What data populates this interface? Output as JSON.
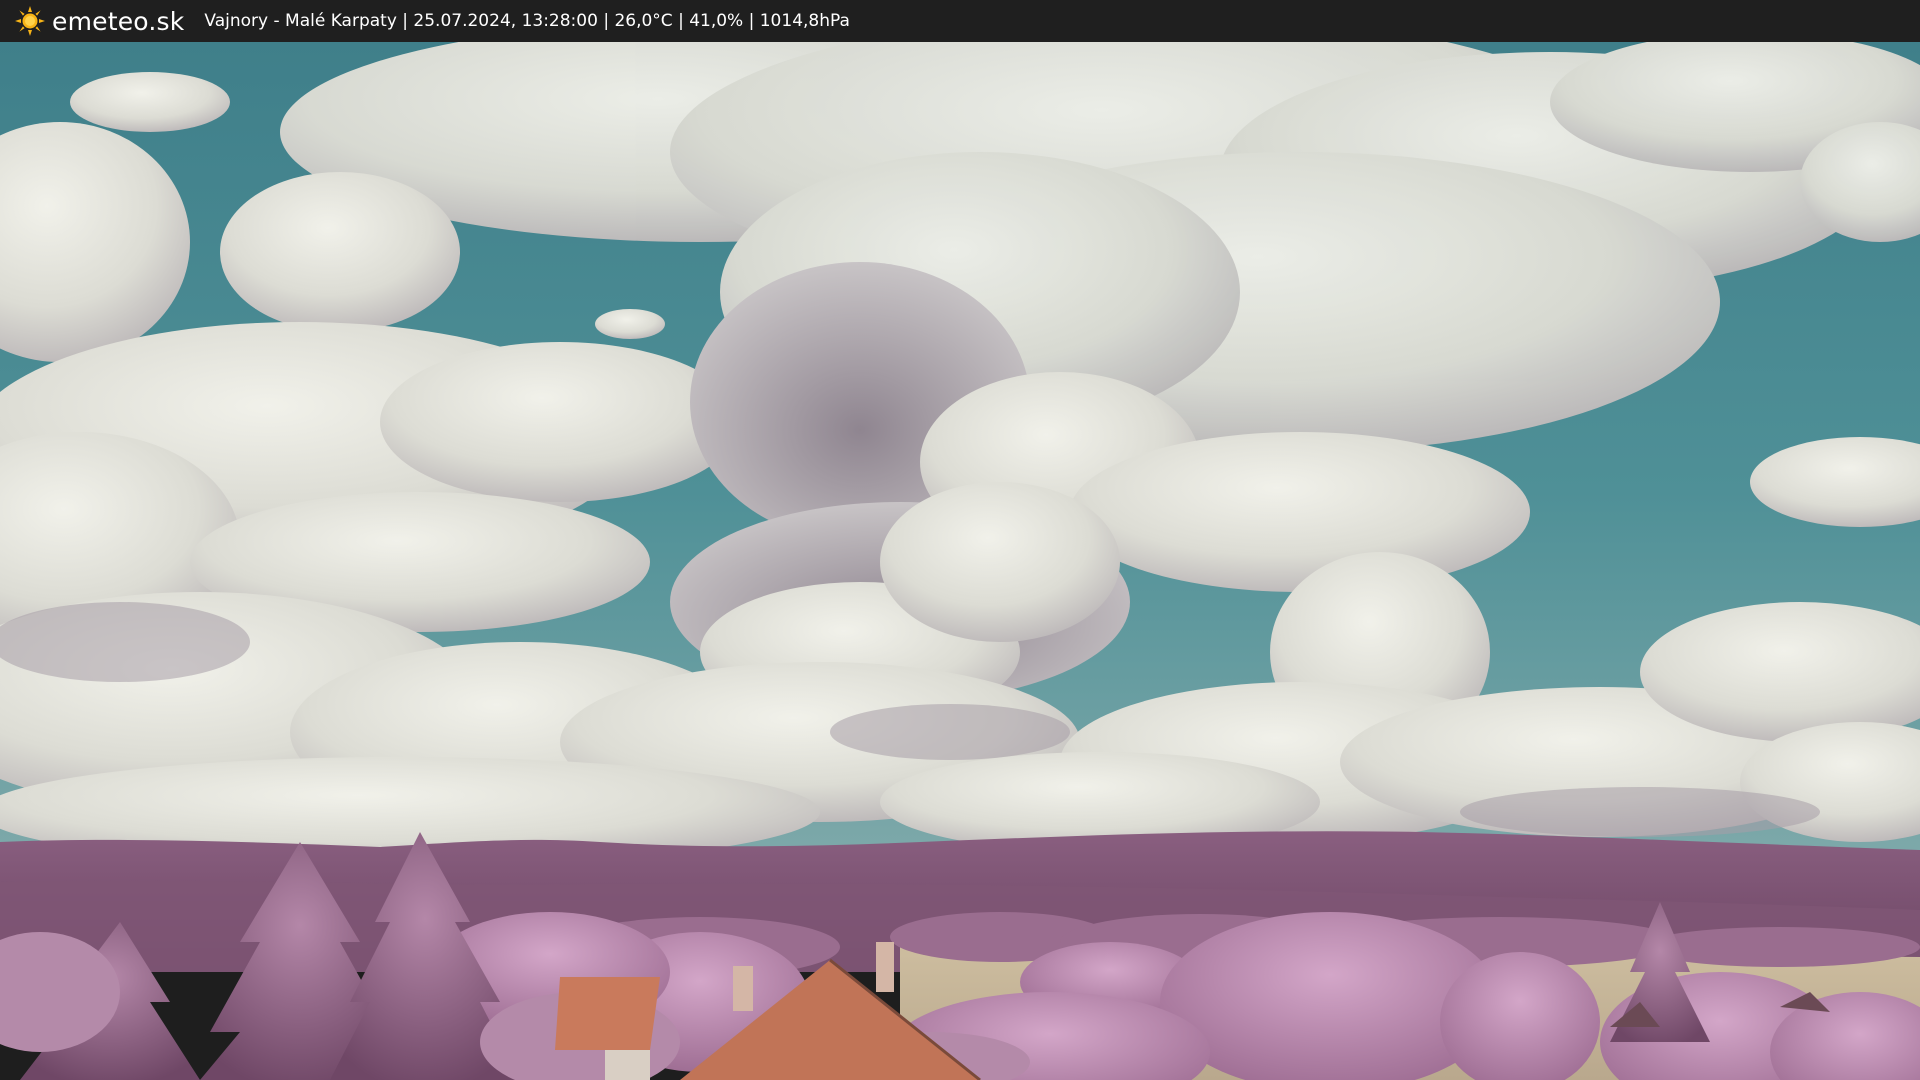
{
  "header": {
    "brand": "emeteo.sk",
    "caption": "Vajnory - Malé Karpaty | 25.07.2024, 13:28:00 | 26,0°C | 41,0% | 1014,8hPa"
  },
  "icons": {
    "logo": "sun-icon"
  },
  "colors": {
    "bar_bg": "#1f1f1f",
    "sky": "#4f8f96",
    "cloud": "#e4e4de",
    "hills": "#7a4f6f",
    "foliage": "#b98aaf",
    "roof": "#c97a5c",
    "field": "#c9b79a",
    "sun": "#f7b417"
  }
}
